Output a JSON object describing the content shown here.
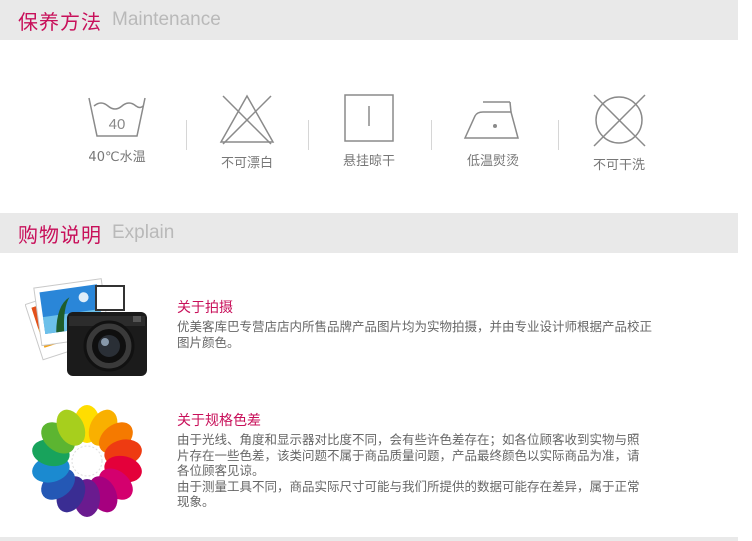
{
  "maintenance": {
    "title_cn": "保养方法",
    "title_en": "Maintenance",
    "wash_temp": "40",
    "items": [
      {
        "icon": "wash-40-icon",
        "label": "40℃水温"
      },
      {
        "icon": "no-bleach-icon",
        "label": "不可漂白"
      },
      {
        "icon": "hang-dry-icon",
        "label": "悬挂晾干"
      },
      {
        "icon": "low-iron-icon",
        "label": "低温熨烫"
      },
      {
        "icon": "no-dry-clean-icon",
        "label": "不可干洗"
      }
    ]
  },
  "explain": {
    "title_cn": "购物说明",
    "title_en": "Explain",
    "blocks": [
      {
        "icon": "camera-photo-icon",
        "title": "关于拍摄",
        "lines": [
          "优美客库巴专营店店内所售品牌产品图片均为实物拍摄，并由专业设计师根据产品校正",
          "图片颜色。"
        ]
      },
      {
        "icon": "color-wheel-icon",
        "title": "关于规格色差",
        "lines": [
          "由于光线、角度和显示器对比度不同，会有些许色差存在；如各位顾客收到实物与照",
          "片存在一些色差，该类问题不属于商品质量问题，产品最终颜色以实际商品为准，请",
          "各位顾客见谅。",
          "由于测量工具不同，商品实际尺寸可能与我们所提供的数据可能存在差异，属于正常",
          "现象。"
        ]
      }
    ]
  },
  "colors": {
    "accent": "#c8105a",
    "header_bg": "#e9e9e9",
    "icon_stroke": "#8a8a8a"
  }
}
